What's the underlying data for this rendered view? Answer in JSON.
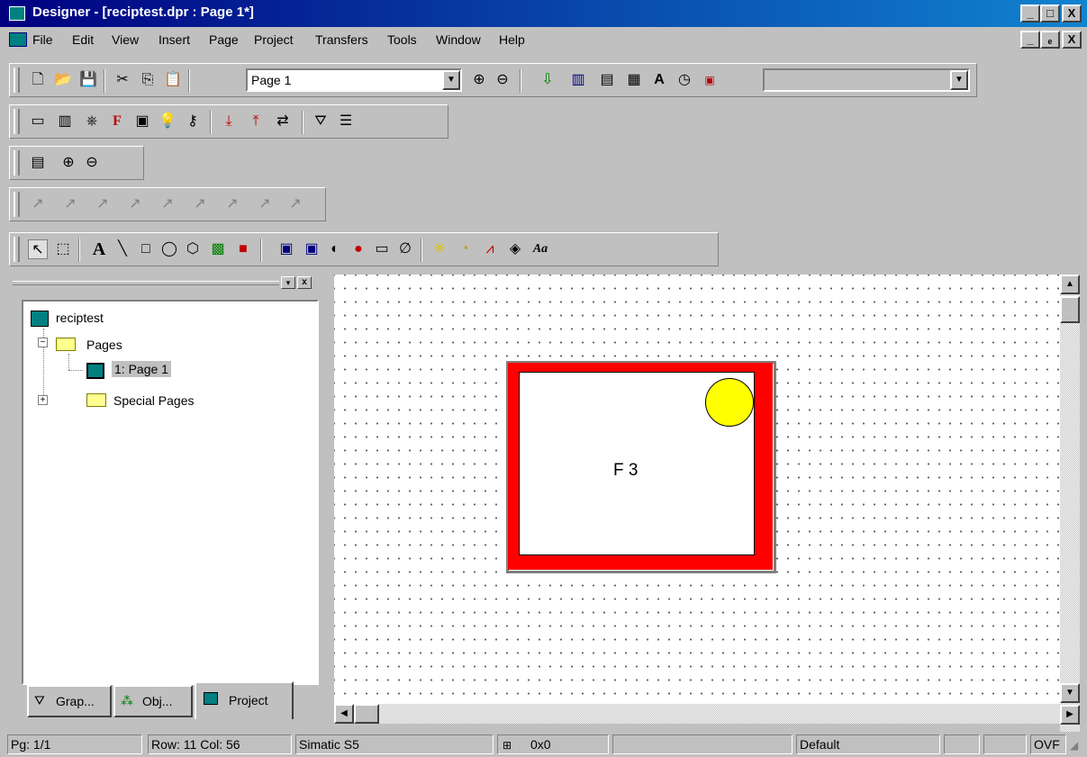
{
  "window": {
    "title": "Designer - [reciptest.dpr : Page 1*]",
    "controls": [
      "_",
      "□",
      "X"
    ],
    "child_controls": [
      "_",
      "ₑ",
      "X"
    ]
  },
  "menu": [
    "File",
    "Edit",
    "View",
    "Insert",
    "Page",
    "Project",
    "Transfers",
    "Tools",
    "Window",
    "Help"
  ],
  "toolbar": {
    "page_select": "Page 1",
    "second_select": ""
  },
  "panel": {
    "tree": {
      "root": "reciptest",
      "pages": "Pages",
      "page1": "1: Page 1",
      "special": "Special Pages"
    },
    "tabs": [
      "Grap...",
      "Obj...",
      "Project"
    ]
  },
  "canvas": {
    "object_text": "F 3"
  },
  "status": {
    "page": "Pg: 1/1",
    "rowcol": "Row: 11  Col: 56",
    "protocol": "Simatic S5",
    "size": "0x0",
    "style": "Default",
    "mode": "OVF"
  },
  "colors": {
    "titlebar": "#000080",
    "object_border": "#ff0000",
    "object_circle": "#ffff00"
  }
}
